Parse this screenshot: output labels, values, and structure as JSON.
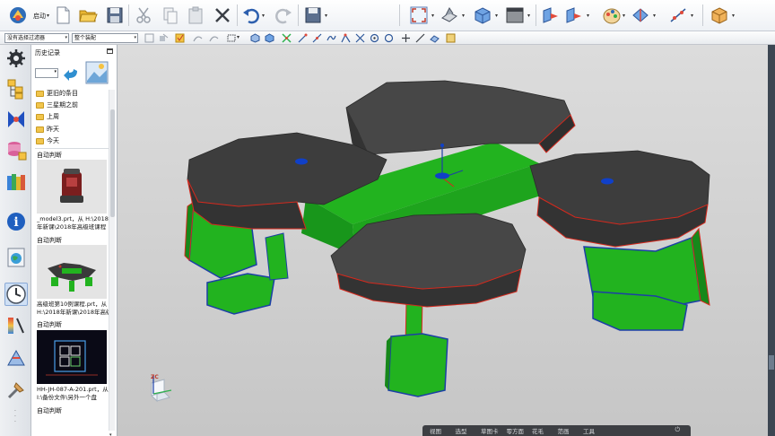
{
  "ribbon": {
    "start_label": "启动",
    "start_caret": "▾",
    "dropdown_caret": "▾",
    "icons": [
      "nx-logo-icon",
      "new-file-icon",
      "open-folder-icon",
      "save-icon",
      "cut-icon",
      "copy-icon",
      "paste-icon",
      "delete-icon",
      "undo-icon",
      "redo-icon",
      "save-as-icon",
      "fit-view-icon",
      "render-style-icon",
      "cube-view-icon",
      "window-icon",
      "extrude-icon",
      "move-face-icon",
      "palette-icon",
      "constraint-icon",
      "snap-icon",
      "package-icon"
    ]
  },
  "selbar": {
    "filter_value": "没有选择过滤器",
    "scope_value": "整个装配",
    "caret": "▾"
  },
  "history": {
    "title": "历史记录",
    "caret": "▾",
    "folders": [
      "更旧的条目",
      "三星期之前",
      "上周",
      "昨天",
      "今天"
    ],
    "sections": [
      {
        "heading": "自动判断",
        "caption_line1": "_model3.prt，从 H:\\2018",
        "caption_line2": "年新课\\2018年高级班课程"
      },
      {
        "heading": "自动判断",
        "caption_line1": "高级班第10例课程.prt，从",
        "caption_line2": "H:\\2018年新课\\2018年高级"
      },
      {
        "heading": "自动判断",
        "caption_line1": "HH-JH-087-A-201.prt，从",
        "caption_line2": "I:\\备份文件\\另外一个盘"
      }
    ],
    "last_heading": "自动判断"
  },
  "viewport": {
    "triad_label": "ZC"
  },
  "tabbar": {
    "tabs": [
      "视图",
      "选型",
      "草图卡",
      "零方面",
      "花毛",
      "范画",
      "工具"
    ],
    "power": "⏻"
  },
  "colors": {
    "cap": "#3a3a3a",
    "cap_top": "#474747",
    "green": "#22b31f",
    "green_dark": "#16881a",
    "edge_red": "#d52a1e",
    "edge_blue": "#1c3fa6",
    "hole_blue": "#1040c8"
  }
}
